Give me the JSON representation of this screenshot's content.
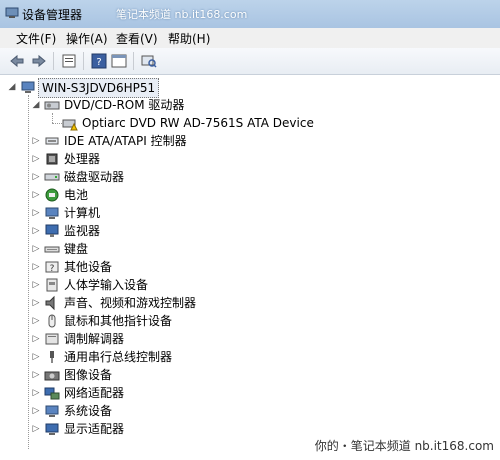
{
  "window": {
    "title": "设备管理器",
    "watermark_top": "笔记本频道 nb.it168.com"
  },
  "menu": [
    {
      "label": "文件(F)"
    },
    {
      "label": "操作(A)"
    },
    {
      "label": "查看(V)"
    },
    {
      "label": "帮助(H)"
    }
  ],
  "toolbar": {
    "icons": [
      "back-icon",
      "forward-icon",
      "properties-icon",
      "help-icon",
      "window-icon",
      "scan-hardware-icon"
    ]
  },
  "tree": {
    "root": "WIN-S3JDVD6HP51",
    "dvd_group": "DVD/CD-ROM 驱动器",
    "dvd_device": "Optiarc DVD RW AD-7561S ATA Device",
    "categories": [
      "IDE ATA/ATAPI 控制器",
      "处理器",
      "磁盘驱动器",
      "电池",
      "计算机",
      "监视器",
      "键盘",
      "其他设备",
      "人体学输入设备",
      "声音、视频和游戏控制器",
      "鼠标和其他指针设备",
      "调制解调器",
      "通用串行总线控制器",
      "图像设备",
      "网络适配器",
      "系统设备",
      "显示适配器"
    ]
  },
  "watermark_bottom": "你的・笔记本频道 nb.it168.com"
}
